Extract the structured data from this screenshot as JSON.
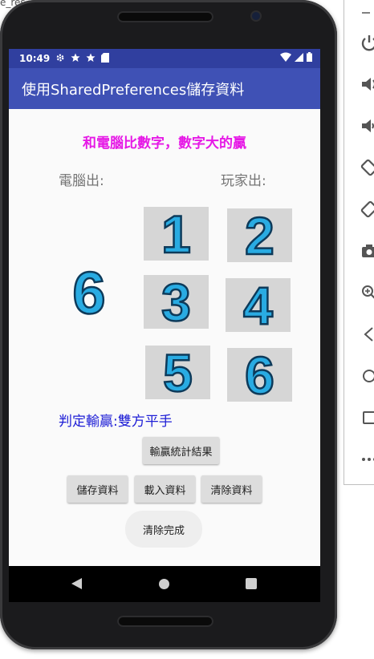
{
  "window": {
    "caption": "e_res"
  },
  "status_bar": {
    "time": "10:49"
  },
  "app_bar": {
    "title": "使用SharedPreferences儲存資料"
  },
  "game": {
    "headline": "和電腦比數字，數字大的贏",
    "computer_label": "電腦出:",
    "player_label": "玩家出:",
    "computer_choice": "6",
    "options": [
      "1",
      "2",
      "3",
      "4",
      "5",
      "6"
    ],
    "result": "判定輸贏:雙方平手"
  },
  "buttons": {
    "stats": "輸贏統計結果",
    "save": "儲存資料",
    "load": "載入資料",
    "clear": "清除資料",
    "done": "清除完成"
  },
  "icons": {
    "status": [
      "gear-icon",
      "star-icon",
      "star-icon",
      "sd-card-icon"
    ],
    "status_right": [
      "wifi-icon",
      "signal-icon",
      "battery-icon"
    ],
    "side_toolbar": [
      "power-icon",
      "volume-up-icon",
      "volume-down-icon",
      "rotate-left-icon",
      "rotate-right-icon",
      "camera-icon",
      "zoom-icon",
      "back-icon",
      "home-icon",
      "overview-icon",
      "more-icon"
    ]
  },
  "colors": {
    "status_bar": "#303f9f",
    "app_bar": "#3f51b5",
    "headline": "#e619e6",
    "result": "#1d1dd6",
    "digit_fill": "#29abe2"
  }
}
